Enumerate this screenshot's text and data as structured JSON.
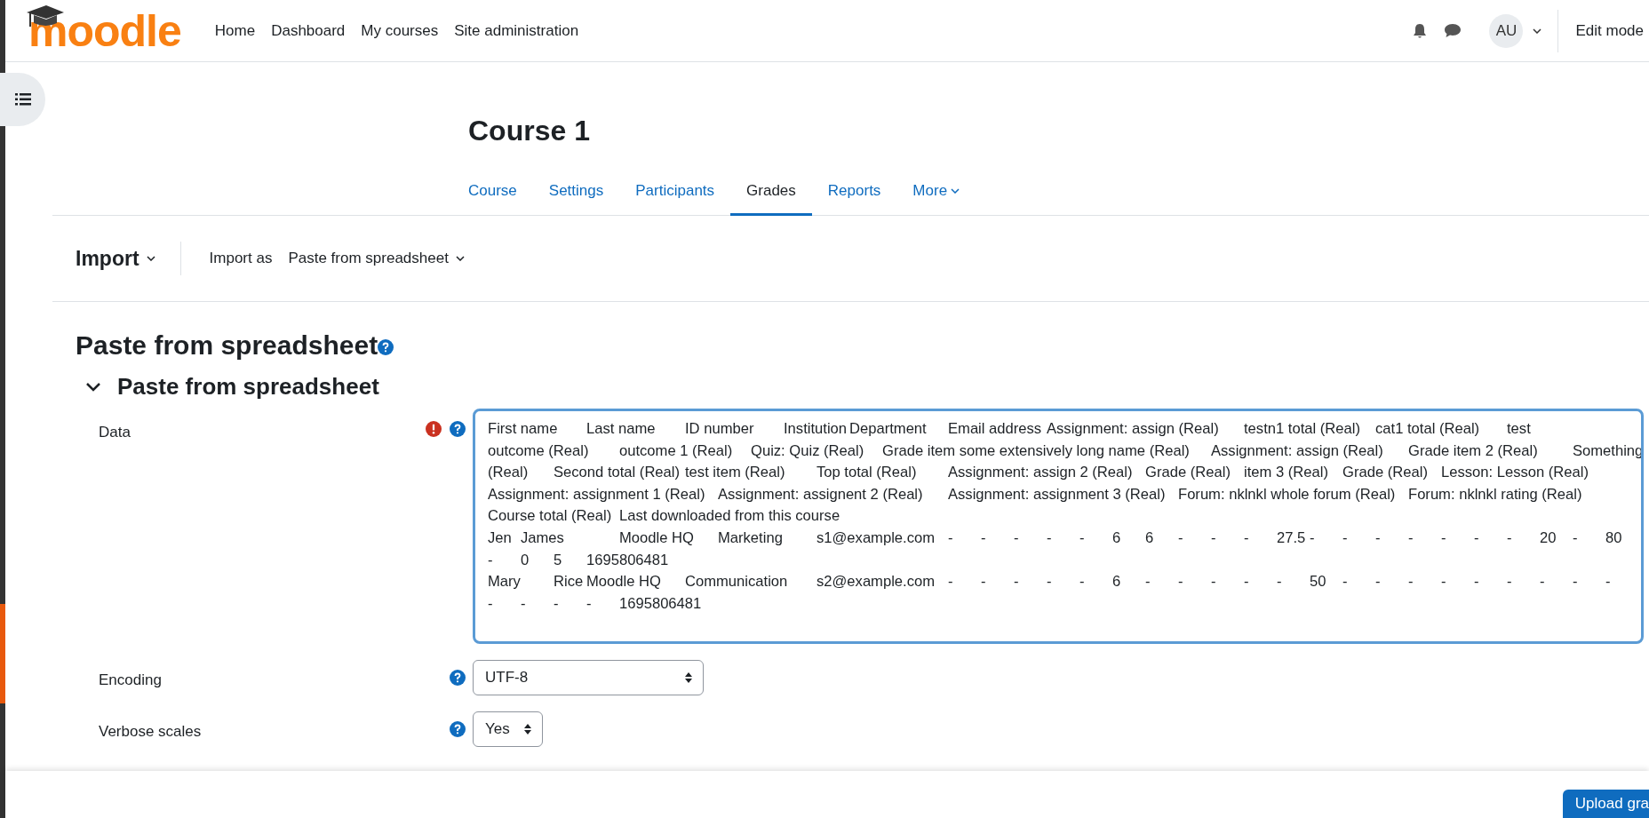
{
  "header": {
    "logo": "moodle",
    "nav": [
      {
        "label": "Home"
      },
      {
        "label": "Dashboard"
      },
      {
        "label": "My courses"
      },
      {
        "label": "Site administration"
      }
    ],
    "avatar": "AU",
    "edit_mode": "Edit mode"
  },
  "course_title": "Course 1",
  "tabs": [
    {
      "label": "Course",
      "selected": false,
      "dropdown": false
    },
    {
      "label": "Settings",
      "selected": false,
      "dropdown": false
    },
    {
      "label": "Participants",
      "selected": false,
      "dropdown": false
    },
    {
      "label": "Grades",
      "selected": true,
      "dropdown": false
    },
    {
      "label": "Reports",
      "selected": false,
      "dropdown": false
    },
    {
      "label": "More",
      "selected": false,
      "dropdown": true
    }
  ],
  "tertiary": {
    "menu": "Import",
    "import_as_label": "Import as",
    "import_as_value": "Paste from spreadsheet"
  },
  "page_title": "Paste from spreadsheet",
  "section": {
    "title": "Paste from spreadsheet",
    "expanded": true
  },
  "fields": [
    {
      "kind": "textarea",
      "label": "Data",
      "required": true,
      "lines": [
        "First name\tLast name\tID number\tInstitution\tDepartment\tEmail address\tAssignment: assign (Real)\ttestn1 total (Real)\tcat1 total (Real)\ttest",
        "outcome (Real)\toutcome 1 (Real)\tQuiz: Quiz (Real)\tGrade item some extensively long name (Real)\tAssignment: assign (Real)\tGrade item 2 (Real)\tSomething",
        "(Real)\tSecond total (Real)\ttest item (Real)\tTop total (Real)\tAssignment: assign 2 (Real)\tGrade (Real)\titem 3 (Real)\tGrade (Real)\tLesson: Lesson (Real)",
        "Assignment: assignment 1 (Real)\tAssignment: assignent 2 (Real)\tAssignment: assignment 3 (Real)\tForum: nklnkl whole forum (Real)\tForum: nklnkl rating (Real)",
        "Course total (Real)\tLast downloaded from this course",
        "Jen\tJames\t\tMoodle HQ\tMarketing\ts1@example.com\t-\t-\t-\t-\t-\t6\t6\t-\t-\t-\t27.5\t-\t-\t-\t-\t-\t-\t-\t20\t-\t80",
        "-\t0\t5\t1695806481",
        "Mary\tRice\tMoodle HQ\tCommunication\ts2@example.com\t-\t-\t-\t-\t-\t6\t-\t-\t-\t-\t-\t50\t-\t-\t-\t-\t-\t-\t-\t-\t-",
        "-\t-\t-\t-\t1695806481"
      ]
    },
    {
      "kind": "select",
      "label": "Encoding",
      "required": false,
      "value": "UTF-8"
    },
    {
      "kind": "select",
      "label": "Verbose scales",
      "required": false,
      "value": "Yes"
    }
  ],
  "footer": {
    "button": "Upload gra"
  }
}
